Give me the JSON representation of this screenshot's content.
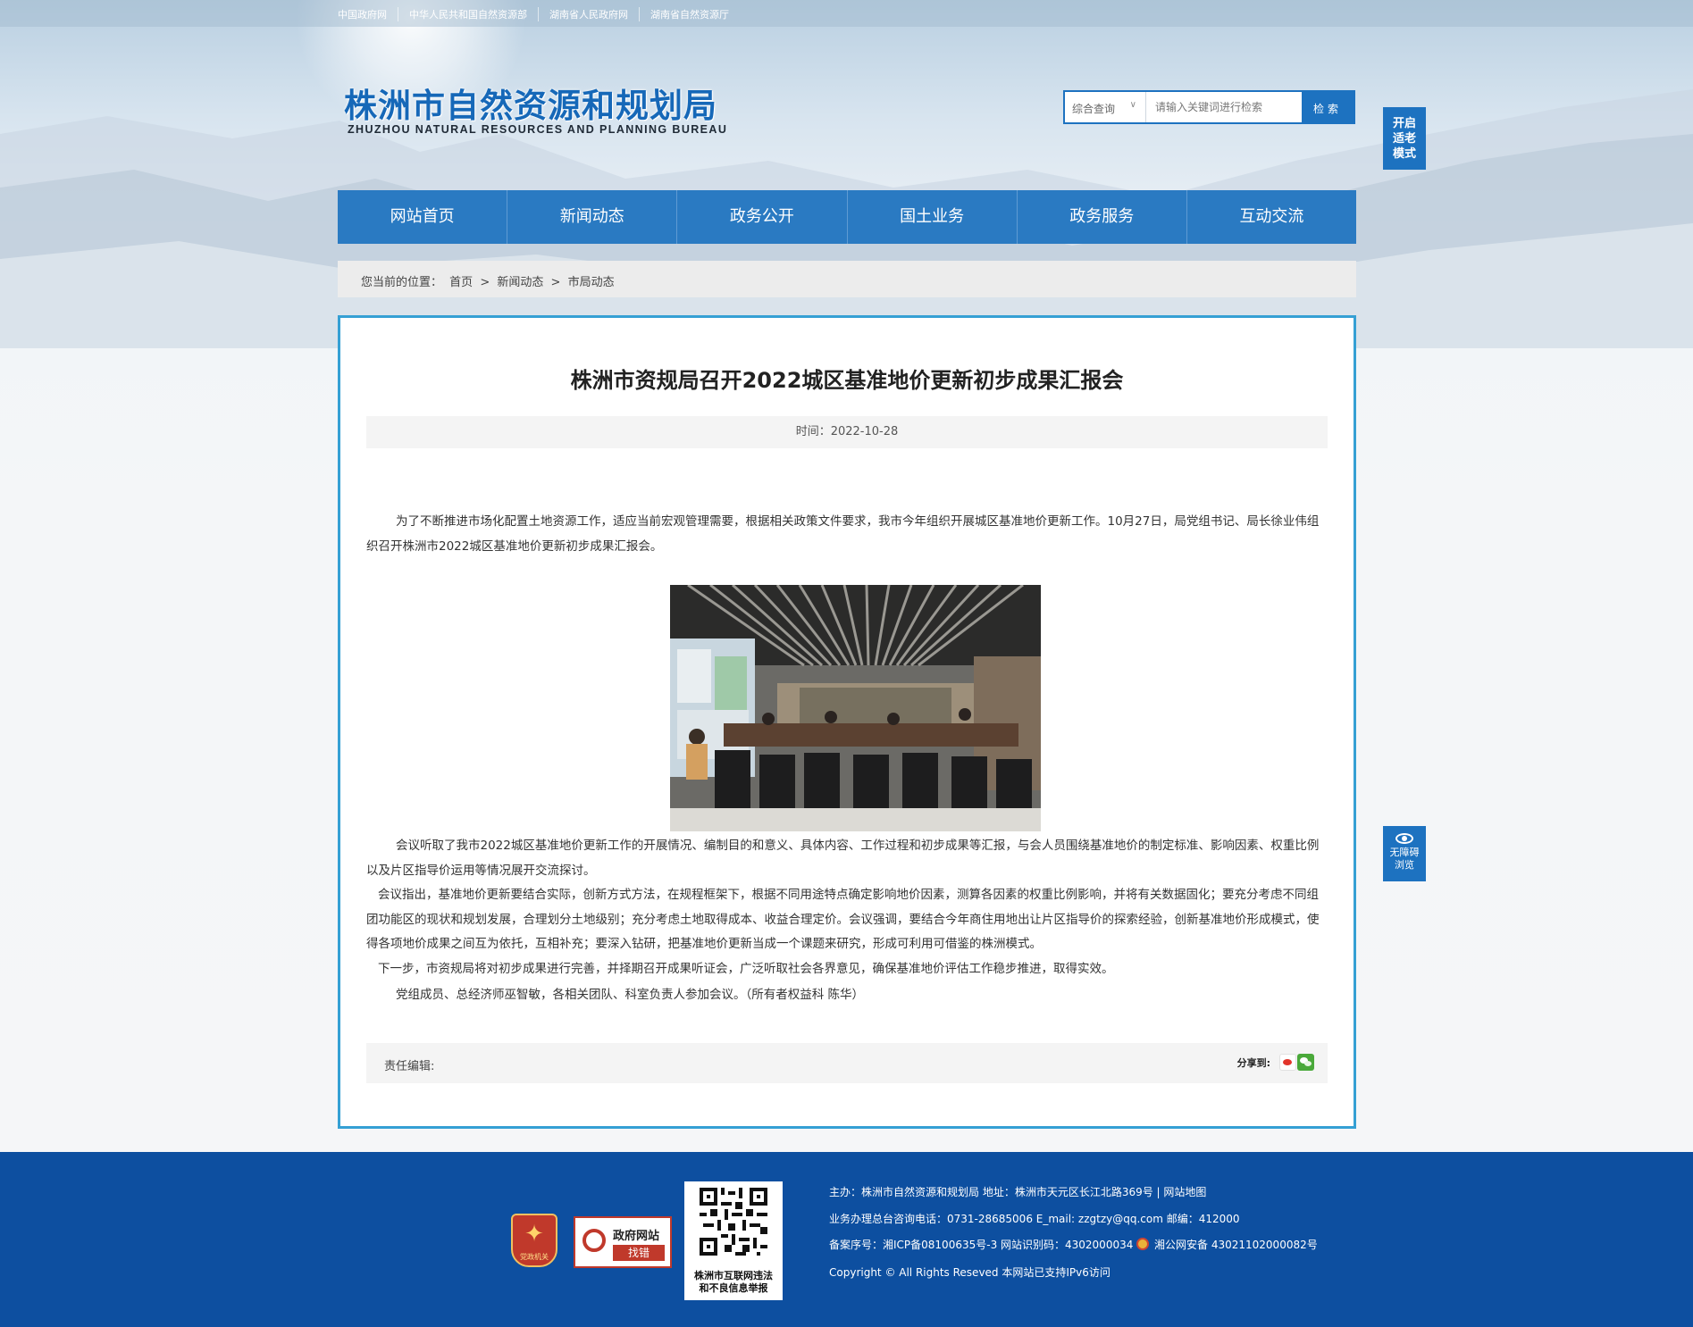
{
  "top_links": [
    "中国政府网",
    "中华人民共和国自然资源部",
    "湖南省人民政府网",
    "湖南省自然资源厅"
  ],
  "logo": {
    "cn": "株洲市自然资源和规划局",
    "en": "ZHUZHOU NATURAL RESOURCES AND PLANNING BUREAU"
  },
  "search": {
    "scope": "综合查询",
    "placeholder": "请输入关键词进行检索",
    "button": "检索"
  },
  "side": {
    "elder_mode": "开启适老模式",
    "accessibility": "无障碍浏览"
  },
  "nav": [
    "网站首页",
    "新闻动态",
    "政务公开",
    "国土业务",
    "政务服务",
    "互动交流"
  ],
  "breadcrumb": {
    "label": "您当前的位置：",
    "items": [
      "首页",
      ">",
      "新闻动态",
      ">",
      "市局动态"
    ]
  },
  "article": {
    "title": "株洲市资规局召开2022城区基准地价更新初步成果汇报会",
    "time": "时间：2022-10-28",
    "paragraphs": [
      "为了不断推进市场化配置土地资源工作，适应当前宏观管理需要，根据相关政策文件要求，我市今年组织开展城区基准地价更新工作。10月27日，局党组书记、局长徐业伟组织召开株洲市2022城区基准地价更新初步成果汇报会。",
      "会议听取了我市2022城区基准地价更新工作的开展情况、编制目的和意义、具体内容、工作过程和初步成果等汇报，与会人员围绕基准地价的制定标准、影响因素、权重比例以及片区指导价运用等情况展开交流探讨。",
      "会议指出，基准地价更新要结合实际，创新方式方法，在规程框架下，根据不同用途特点确定影响地价因素，测算各因素的权重比例影响，并将有关数据固化；要充分考虑不同组团功能区的现状和规划发展，合理划分土地级别；充分考虑土地取得成本、收益合理定价。会议强调，要结合今年商住用地出让片区指导价的探索经验，创新基准地价形成模式，使得各项地价成果之间互为依托，互相补充；要深入钻研，把基准地价更新当成一个课题来研究，形成可利用可借鉴的株洲模式。",
      "下一步，市资规局将对初步成果进行完善，并择期召开成果听证会，广泛听取社会各界意见，确保基准地价评估工作稳步推进，取得实效。",
      "党组成员、总经济师巫智敏，各相关团队、科室负责人参加会议。（所有者权益科  陈华）"
    ],
    "editor_label": "责任编辑:",
    "share_label": "分享到:"
  },
  "footer": {
    "badge1_text": "党政机关",
    "badge2_line1": "政府网站",
    "badge2_line2": "找错",
    "qr_caption_1": "株洲市互联网违法",
    "qr_caption_2": "和不良信息举报",
    "line1": "主办：株洲市自然资源和规划局   地址：株洲市天元区长江北路369号  |  网站地图",
    "line2": "业务办理总台咨询电话：0731-28685006    E_mail:    zzgtzy@qq.com     邮编：412000",
    "line3_a": "备案序号：湘ICP备08100635号-3  网站识别码：4302000034",
    "line3_b": "湘公网安备 43021102000082号",
    "line4": "Copyright © All Rights Reseved 本网站已支持IPv6访问"
  }
}
